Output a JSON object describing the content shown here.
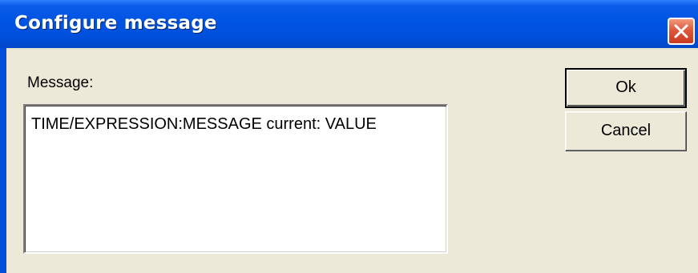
{
  "window": {
    "title": "Configure message",
    "close_icon": "close-icon"
  },
  "form": {
    "message_label": "Message:",
    "message_value": "TIME/EXPRESSION:MESSAGE current: VALUE"
  },
  "buttons": {
    "ok_label": "Ok",
    "cancel_label": "Cancel"
  },
  "colors": {
    "titlebar": "#0054e3",
    "close_button": "#e0583b",
    "dialog_background": "#ece9d8"
  }
}
